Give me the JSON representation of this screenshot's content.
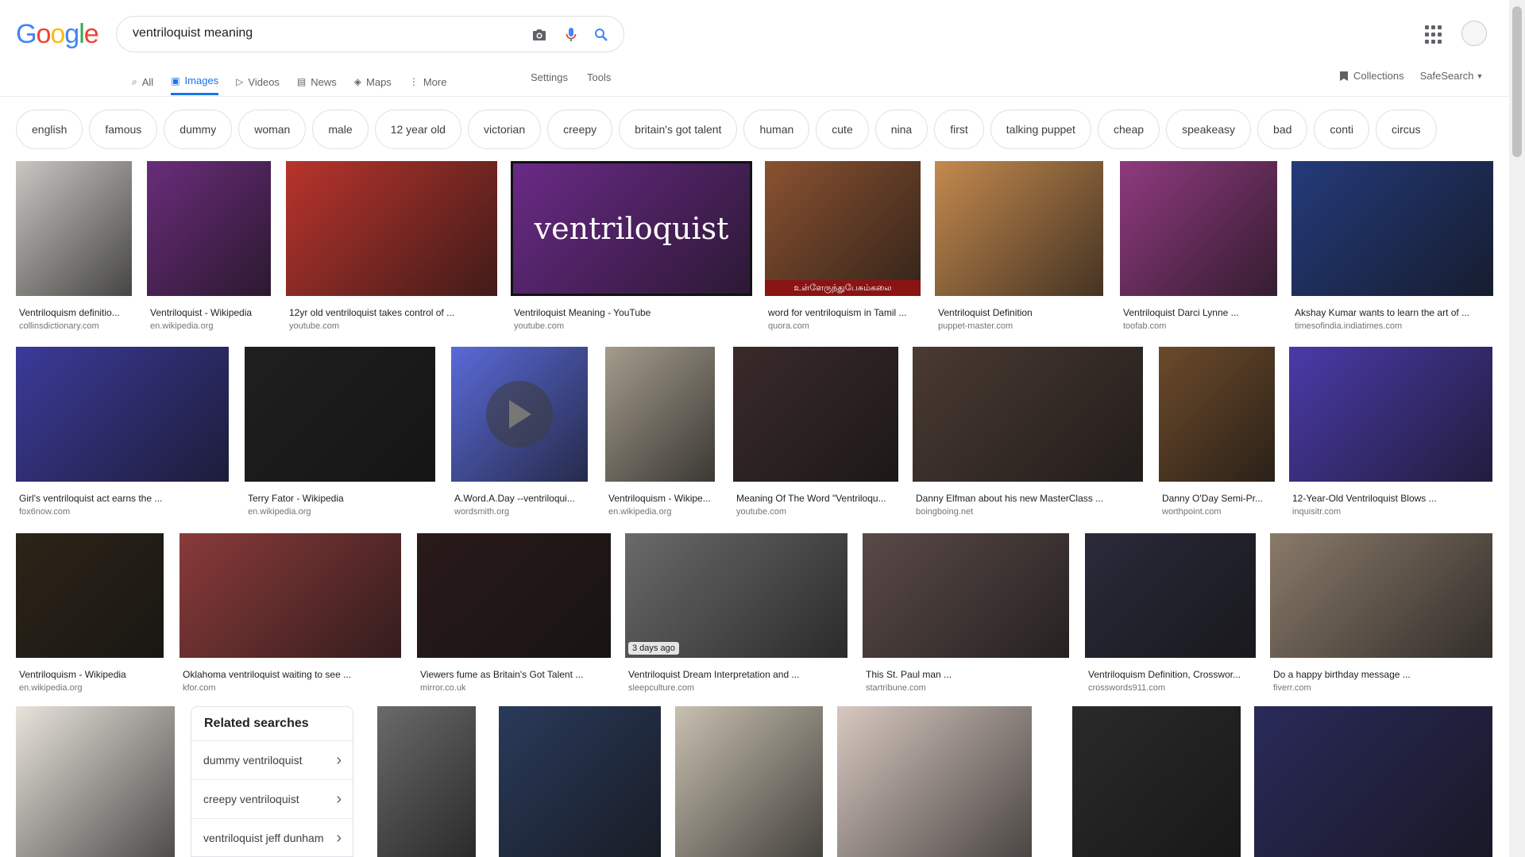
{
  "logo": {
    "letters": [
      "G",
      "o",
      "o",
      "g",
      "l",
      "e"
    ],
    "colors": [
      "#4285F4",
      "#EA4335",
      "#FBBC05",
      "#4285F4",
      "#34A853",
      "#EA4335"
    ]
  },
  "search": {
    "value": "ventriloquist meaning"
  },
  "tabs": [
    {
      "label": "All",
      "icon": "search-icon",
      "active": false
    },
    {
      "label": "Images",
      "icon": "image-icon",
      "active": true
    },
    {
      "label": "Videos",
      "icon": "video-icon",
      "active": false
    },
    {
      "label": "News",
      "icon": "news-icon",
      "active": false
    },
    {
      "label": "Maps",
      "icon": "map-icon",
      "active": false
    },
    {
      "label": "More",
      "icon": "more-vert-icon",
      "active": false
    }
  ],
  "tools": {
    "settings": "Settings",
    "tools": "Tools"
  },
  "right_tools": {
    "collections": "Collections",
    "safesearch": "SafeSearch"
  },
  "chips": [
    "english",
    "famous",
    "dummy",
    "woman",
    "male",
    "12 year old",
    "victorian",
    "creepy",
    "britain's got talent",
    "human",
    "cute",
    "nina",
    "first",
    "talking puppet",
    "cheap",
    "speakeasy",
    "bad",
    "conti",
    "circus"
  ],
  "rows": [
    [
      {
        "title": "Ventriloquism definitio...",
        "site": "collinsdictionary.com",
        "color": "#c9c7c2"
      },
      {
        "title": "Ventriloquist - Wikipedia",
        "site": "en.wikipedia.org",
        "color": "#6a2c7a"
      },
      {
        "title": "12yr old ventriloquist takes control of ...",
        "site": "youtube.com",
        "color": "#b8342c"
      },
      {
        "title": "Ventriloquist Meaning - YouTube",
        "site": "youtube.com",
        "color": "#6b2a88",
        "overlay": "ventriloquist"
      },
      {
        "title": "word for ventriloquism in Tamil ...",
        "site": "quora.com",
        "color": "#8a5230",
        "caption": "உள்ளேருந்துபேசும்கலை"
      },
      {
        "title": "Ventriloquist Definition",
        "site": "puppet-master.com",
        "color": "#c48a4e"
      },
      {
        "title": "Ventriloquist Darci Lynne ...",
        "site": "toofab.com",
        "color": "#8e3a7e"
      },
      {
        "title": "Akshay Kumar wants to learn the art of ...",
        "site": "timesofindia.indiatimes.com",
        "color": "#243a7a"
      }
    ],
    [
      {
        "title": "Girl's ventriloquist act earns the ...",
        "site": "fox6now.com",
        "color": "#3b3a9a"
      },
      {
        "title": "Terry Fator - Wikipedia",
        "site": "en.wikipedia.org",
        "color": "#1f1f1f"
      },
      {
        "title": "A.Word.A.Day --ventriloqui...",
        "site": "wordsmith.org",
        "color": "#5a6ad8"
      },
      {
        "title": "Ventriloquism - Wikipe...",
        "site": "en.wikipedia.org",
        "color": "#a49c8c"
      },
      {
        "title": "Meaning Of The Word \"Ventriloqu...",
        "site": "youtube.com",
        "color": "#3a2a2a"
      },
      {
        "title": "Danny Elfman about his new MasterClass ...",
        "site": "boingboing.net",
        "color": "#4a3a32"
      },
      {
        "title": "Danny O'Day Semi-Pr...",
        "site": "worthpoint.com",
        "color": "#6b4a2a"
      },
      {
        "title": "12-Year-Old Ventriloquist Blows ...",
        "site": "inquisitr.com",
        "color": "#4a3aa8"
      }
    ],
    [
      {
        "title": "Ventriloquism - Wikipedia",
        "site": "en.wikipedia.org",
        "color": "#2c2418"
      },
      {
        "title": "Oklahoma ventriloquist waiting to see ...",
        "site": "kfor.com",
        "color": "#8a3a3a"
      },
      {
        "title": "Viewers fume as Britain's Got Talent ...",
        "site": "mirror.co.uk",
        "color": "#2a1a1a"
      },
      {
        "title": "Ventriloquist Dream Interpretation and ...",
        "site": "sleepculture.com",
        "color": "#6a6a6a",
        "badge": "3 days ago"
      },
      {
        "title": "This St. Paul man ...",
        "site": "startribune.com",
        "color": "#5a4a48"
      },
      {
        "title": "Ventriloquism Definition, Crosswor...",
        "site": "crosswords911.com",
        "color": "#2a2a3a"
      },
      {
        "title": "Do a happy birthday message ...",
        "site": "fiverr.com",
        "color": "#8a7a6a"
      }
    ],
    [
      {
        "color": "#e8e4dc"
      },
      {
        "color": "#6a6a6a"
      },
      {
        "color": "#2a3a5a"
      },
      {
        "color": "#c8c0b0"
      },
      {
        "color": "#d8c8c0"
      },
      {
        "color": "#2a2a2a"
      },
      {
        "color": "#2a2a5a"
      }
    ]
  ],
  "related": {
    "title": "Related searches",
    "items": [
      "dummy ventriloquist",
      "creepy ventriloquist",
      "ventriloquist jeff dunham"
    ]
  }
}
